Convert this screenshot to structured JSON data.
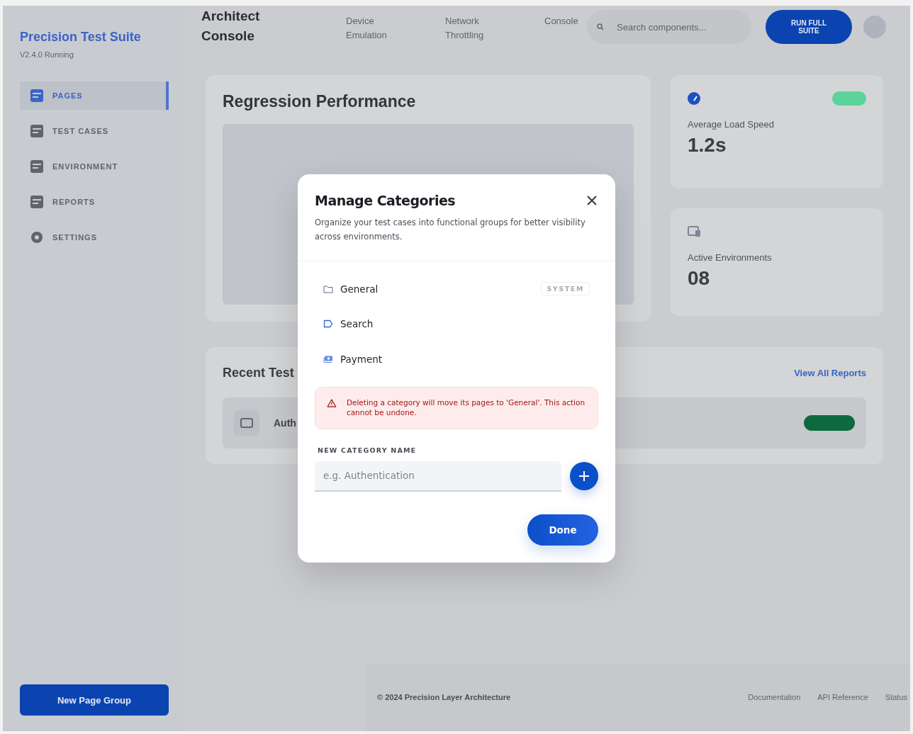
{
  "sidebar": {
    "brand": "Precision Test Suite",
    "version": "V2.4.0 Running",
    "items": [
      {
        "label": "PAGES",
        "kind": "pages",
        "selected": true
      },
      {
        "label": "TEST CASES",
        "kind": "cases",
        "selected": false
      },
      {
        "label": "ENVIRONMENT",
        "kind": "env",
        "selected": false
      },
      {
        "label": "REPORTS",
        "kind": "reports",
        "selected": false
      },
      {
        "label": "SETTINGS",
        "kind": "settings",
        "selected": false
      }
    ],
    "new_button": "New Page Group"
  },
  "header": {
    "title": "Architect Console",
    "nav": [
      "Device Emulation",
      "Network Throttling",
      "Console"
    ],
    "search": {
      "placeholder": "Search components..."
    },
    "run_button": "RUN FULL SUITE"
  },
  "performance": {
    "title": "Regression Performance"
  },
  "stats": [
    {
      "kind": "speed",
      "label": "Average Load Speed",
      "value": "1.2s"
    },
    {
      "kind": "environments",
      "label": "Active Environments",
      "value": "08"
    }
  ],
  "recent": {
    "title": "Recent Test",
    "link": "View All Reports",
    "rows": [
      {
        "name": "Auth"
      }
    ]
  },
  "footer": {
    "copyright": "© 2024 Precision Layer Architecture",
    "links": [
      "Documentation",
      "API Reference",
      "Status"
    ]
  },
  "modal": {
    "title": "Manage Categories",
    "description": "Organize your test cases into functional groups for better visibility across environments.",
    "categories": [
      {
        "name": "General",
        "kind": "folder",
        "badge": "SYSTEM"
      },
      {
        "name": "Search",
        "kind": "tag"
      },
      {
        "name": "Payment",
        "kind": "payment"
      }
    ],
    "warning": "Deleting a category will move its pages to 'General'. This action cannot be undone.",
    "field": {
      "label": "NEW CATEGORY NAME",
      "placeholder": "e.g. Authentication"
    },
    "done_button": "Done"
  }
}
